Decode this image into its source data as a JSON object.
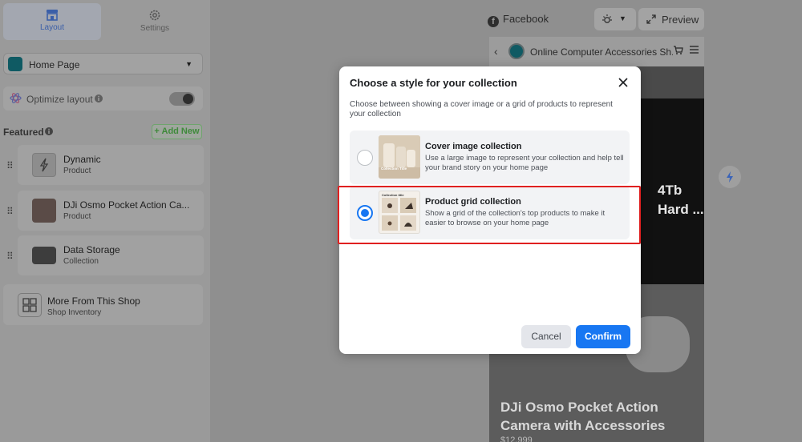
{
  "sidebar": {
    "tabs": [
      {
        "label": "Layout",
        "active": true
      },
      {
        "label": "Settings",
        "active": false
      }
    ],
    "page_select": {
      "value": "Home Page"
    },
    "optimize": {
      "label": "Optimize layout",
      "enabled": false
    },
    "featured": {
      "label": "Featured",
      "add_button": "+ Add New"
    },
    "items": [
      {
        "name": "Dynamic",
        "type": "Product"
      },
      {
        "name": "DJi Osmo Pocket Action Ca...",
        "type": "Product"
      },
      {
        "name": "Data Storage",
        "type": "Collection"
      },
      {
        "name": "More From This Shop",
        "type": "Shop Inventory"
      }
    ]
  },
  "toolbar": {
    "platform": "Facebook",
    "preview_label": "Preview"
  },
  "phone": {
    "shop_name": "Online Computer Accessories Sh...",
    "banner_text": "4Tb\nHard ...",
    "product_title": "DJi Osmo Pocket Action Camera with Accessories",
    "price": "$12,999"
  },
  "modal": {
    "title": "Choose a style for your collection",
    "description": "Choose between showing a cover image or a grid of products to represent your collection",
    "options": [
      {
        "title": "Cover image collection",
        "description": "Use a large image to represent your collection and help tell your brand story on your home page",
        "thumb_text": "Collection Title",
        "selected": false
      },
      {
        "title": "Product grid collection",
        "description": "Show a grid of the collection's top products to make it easier to browse on your home page",
        "thumb_text": "Collection title",
        "selected": true
      }
    ],
    "cancel_label": "Cancel",
    "confirm_label": "Confirm"
  },
  "colors": {
    "accent": "#1877f2",
    "highlight": "#e02020",
    "add_new": "#3f8a3b"
  }
}
